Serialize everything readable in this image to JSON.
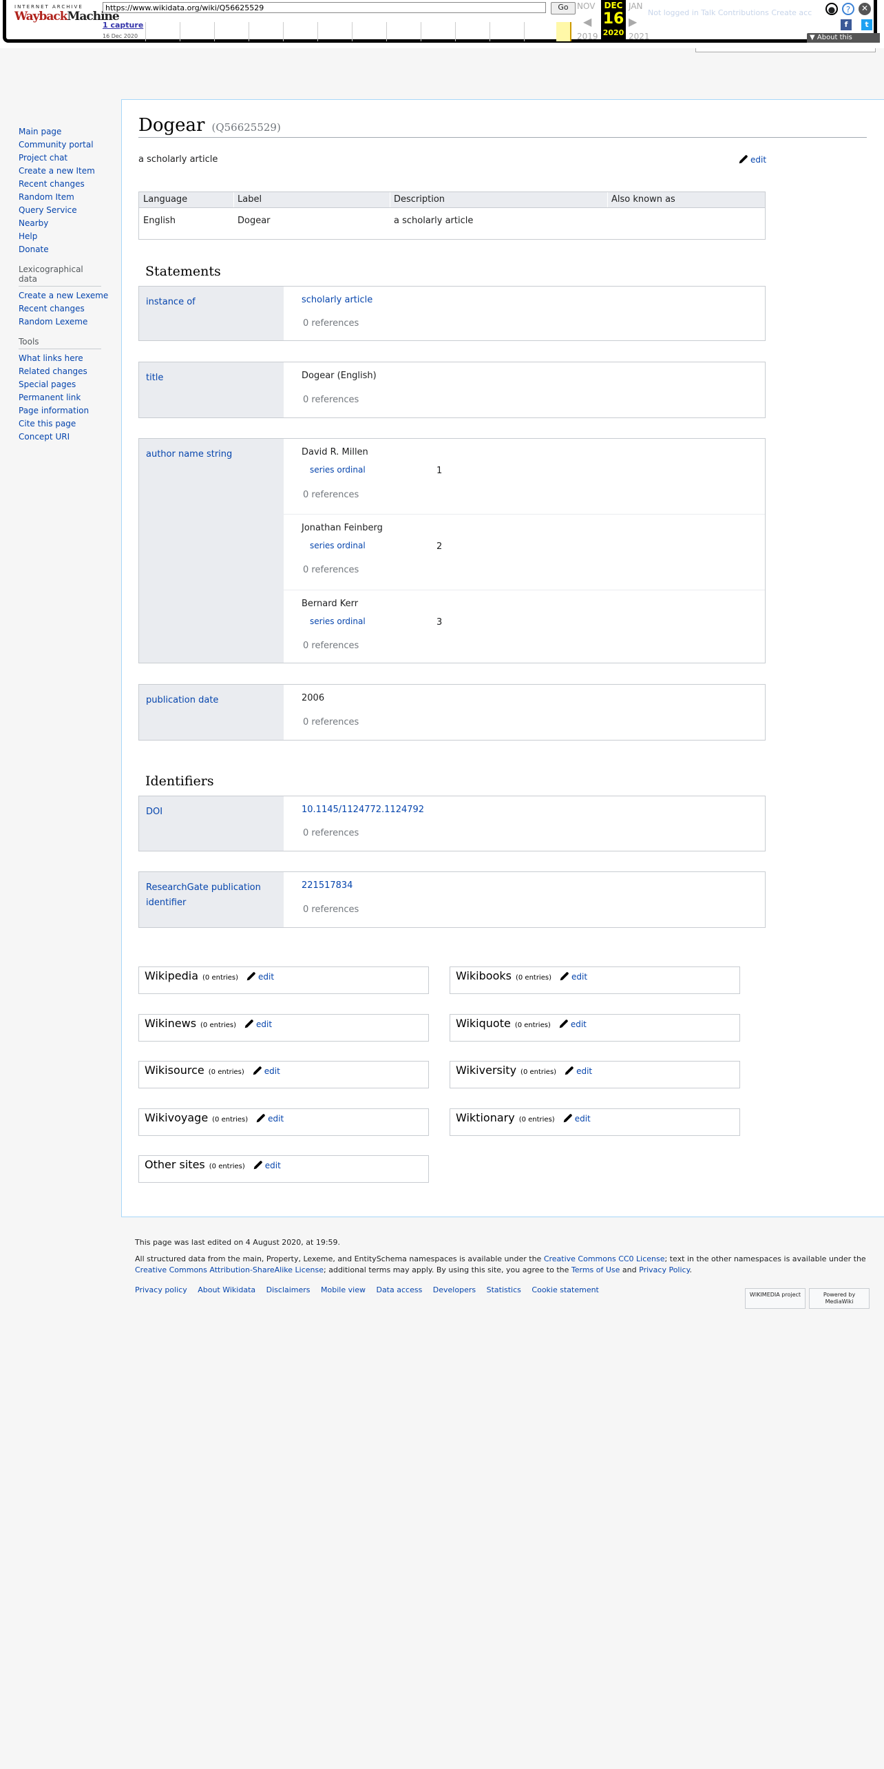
{
  "wayback": {
    "url": "https://www.wikidata.org/wiki/Q56625529",
    "go_label": "Go",
    "captures_label": "1 capture",
    "capture_date": "16 Dec 2020",
    "prev_month": "NOV",
    "cur_month": "DEC",
    "next_month": "JAN",
    "cur_day": "16",
    "prev_year": "2019",
    "cur_year": "2020",
    "next_year": "2021",
    "about_label": "About this capture",
    "personal_hint": "Not logged in   Talk   Contributions   Create acc"
  },
  "sidebar": {
    "nav": [
      "Main page",
      "Community portal",
      "Project chat",
      "Create a new Item",
      "Recent changes",
      "Random Item",
      "Query Service",
      "Nearby",
      "Help",
      "Donate"
    ],
    "lex_heading": "Lexicographical data",
    "lex": [
      "Create a new Lexeme",
      "Recent changes",
      "Random Lexeme"
    ],
    "tools_heading": "Tools",
    "tools": [
      "What links here",
      "Related changes",
      "Special pages",
      "Permanent link",
      "Page information",
      "Cite this page",
      "Concept URI"
    ]
  },
  "item": {
    "label": "Dogear",
    "qid": "(Q56625529)",
    "description": "a scholarly article",
    "edit_label": "edit"
  },
  "terms": {
    "headers": [
      "Language",
      "Label",
      "Description",
      "Also known as"
    ],
    "row": [
      "English",
      "Dogear",
      "a scholarly article",
      ""
    ]
  },
  "statements_heading": "Statements",
  "statements": {
    "instance_of": {
      "prop": "instance of",
      "value": "scholarly article",
      "refs": "0 references"
    },
    "title": {
      "prop": "title",
      "value": "Dogear (English)",
      "refs": "0 references"
    },
    "authors": {
      "prop": "author name string",
      "values": [
        {
          "name": "David R. Millen",
          "qual": "series ordinal",
          "qval": "1",
          "refs": "0 references"
        },
        {
          "name": "Jonathan Feinberg",
          "qual": "series ordinal",
          "qval": "2",
          "refs": "0 references"
        },
        {
          "name": "Bernard Kerr",
          "qual": "series ordinal",
          "qval": "3",
          "refs": "0 references"
        }
      ]
    },
    "pubdate": {
      "prop": "publication date",
      "value": "2006",
      "refs": "0 references"
    }
  },
  "identifiers_heading": "Identifiers",
  "identifiers": {
    "doi": {
      "prop": "DOI",
      "value": "10.1145/1124772.1124792",
      "refs": "0 references"
    },
    "researchgate": {
      "prop": "ResearchGate publication identifier",
      "value": "221517834",
      "refs": "0 references"
    }
  },
  "sitelinks": [
    {
      "name": "Wikipedia",
      "entries": "(0 entries)",
      "edit": "edit"
    },
    {
      "name": "Wikibooks",
      "entries": "(0 entries)",
      "edit": "edit"
    },
    {
      "name": "Wikinews",
      "entries": "(0 entries)",
      "edit": "edit"
    },
    {
      "name": "Wikiquote",
      "entries": "(0 entries)",
      "edit": "edit"
    },
    {
      "name": "Wikisource",
      "entries": "(0 entries)",
      "edit": "edit"
    },
    {
      "name": "Wikiversity",
      "entries": "(0 entries)",
      "edit": "edit"
    },
    {
      "name": "Wikivoyage",
      "entries": "(0 entries)",
      "edit": "edit"
    },
    {
      "name": "Wiktionary",
      "entries": "(0 entries)",
      "edit": "edit"
    },
    {
      "name": "Other sites",
      "entries": "(0 entries)",
      "edit": "edit"
    }
  ],
  "footer": {
    "last_edited": "This page was last edited on 4 August 2020, at 19:59.",
    "license_1": "All structured data from the main, Property, Lexeme, and EntitySchema namespaces is available under the ",
    "license_cc0": "Creative Commons CC0 License",
    "license_2": "; text in the other namespaces is available under the ",
    "license_ccbysa": "Creative Commons Attribution-ShareAlike License",
    "license_3": "; additional terms may apply. By using this site, you agree to the ",
    "license_terms": "Terms of Use",
    "license_and": " and ",
    "license_privacy": "Privacy Policy",
    "license_end": ".",
    "links": [
      "Privacy policy",
      "About Wikidata",
      "Disclaimers",
      "Mobile view",
      "Data access",
      "Developers",
      "Statistics",
      "Cookie statement"
    ],
    "badge_wikimedia": "WIKIMEDIA project",
    "badge_mediawiki": "Powered by MediaWiki"
  },
  "colors": {
    "link": "#0645ad",
    "prop_bg": "#eaecf0",
    "border": "#c8ccd1",
    "wayback_yellow": "#ffff00"
  }
}
